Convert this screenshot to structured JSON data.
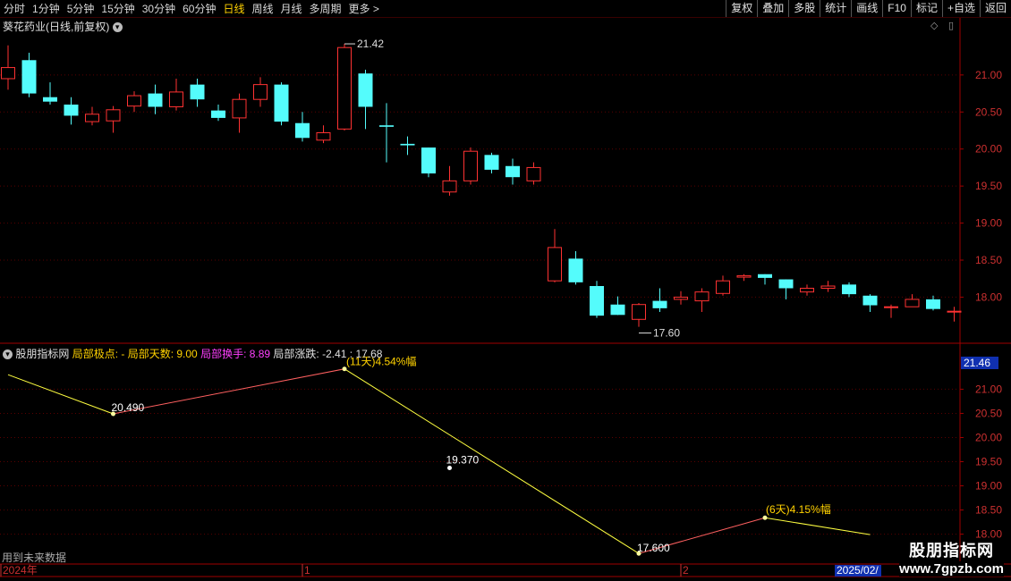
{
  "toolbar": {
    "periods": [
      "分时",
      "1分钟",
      "5分钟",
      "15分钟",
      "30分钟",
      "60分钟",
      "日线",
      "周线",
      "月线",
      "多周期",
      "更多 >"
    ],
    "active_period": "日线",
    "right_buttons": [
      "复权",
      "叠加",
      "多股",
      "统计",
      "画线",
      "F10",
      "标记",
      "+自选",
      "返回"
    ]
  },
  "main_chart": {
    "title": "葵花药业(日线,前复权)",
    "price_ticks": [
      "21.00",
      "20.50",
      "20.00",
      "19.50",
      "19.00",
      "18.50",
      "18.00"
    ],
    "high_label": "21.42",
    "low_label": "17.60"
  },
  "indicator": {
    "name": "股朋指标网",
    "items": [
      {
        "label": "局部极点: -",
        "color": "#ffd200"
      },
      {
        "label": "局部天数: 9.00",
        "color": "#ffd200"
      },
      {
        "label": "局部换手: 8.89",
        "color": "#ff40ff"
      },
      {
        "label": "局部涨跌: -2.41 : 17.68",
        "color": "#e0e0e0"
      }
    ],
    "ticks": [
      "21.00",
      "20.50",
      "20.00",
      "19.50",
      "19.00",
      "18.50",
      "18.00"
    ],
    "current_value": "21.46",
    "labels": [
      "20.490",
      "(11天)4.54%幅",
      "19.370",
      "17.600",
      "(6天)4.15%幅"
    ],
    "footer_note": "用到未来数据"
  },
  "time_axis": {
    "labels": [
      "2024年",
      "1",
      "2",
      "2025/02/"
    ]
  },
  "watermark": {
    "name": "股朋指标网",
    "url": "www.7gpzb.com"
  },
  "colors": {
    "up": "#ff3232",
    "down": "#54fcfc",
    "axis": "#a00000",
    "label": "#ffd200"
  },
  "chart_data": {
    "type": "candlestick",
    "series": [
      {
        "o": 20.95,
        "c": 21.1,
        "h": 21.4,
        "l": 20.8
      },
      {
        "o": 21.2,
        "c": 20.75,
        "h": 21.3,
        "l": 20.7
      },
      {
        "o": 20.7,
        "c": 20.64,
        "h": 20.9,
        "l": 20.6
      },
      {
        "o": 20.6,
        "c": 20.45,
        "h": 20.7,
        "l": 20.33
      },
      {
        "o": 20.37,
        "c": 20.47,
        "h": 20.57,
        "l": 20.32
      },
      {
        "o": 20.38,
        "c": 20.53,
        "h": 20.58,
        "l": 20.22
      },
      {
        "o": 20.58,
        "c": 20.72,
        "h": 20.78,
        "l": 20.5
      },
      {
        "o": 20.75,
        "c": 20.57,
        "h": 20.87,
        "l": 20.47
      },
      {
        "o": 20.57,
        "c": 20.77,
        "h": 20.95,
        "l": 20.52
      },
      {
        "o": 20.87,
        "c": 20.67,
        "h": 20.95,
        "l": 20.57
      },
      {
        "o": 20.52,
        "c": 20.42,
        "h": 20.6,
        "l": 20.38
      },
      {
        "o": 20.42,
        "c": 20.67,
        "h": 20.75,
        "l": 20.22
      },
      {
        "o": 20.67,
        "c": 20.87,
        "h": 20.97,
        "l": 20.57
      },
      {
        "o": 20.87,
        "c": 20.37,
        "h": 20.9,
        "l": 20.32
      },
      {
        "o": 20.35,
        "c": 20.15,
        "h": 20.5,
        "l": 20.1
      },
      {
        "o": 20.12,
        "c": 20.22,
        "h": 20.32,
        "l": 20.08
      },
      {
        "o": 20.27,
        "c": 21.37,
        "h": 21.42,
        "l": 20.25
      },
      {
        "o": 21.02,
        "c": 20.57,
        "h": 21.07,
        "l": 20.27
      },
      {
        "o": 20.32,
        "c": 20.3,
        "h": 20.62,
        "l": 19.82
      },
      {
        "o": 20.07,
        "c": 20.05,
        "h": 20.17,
        "l": 19.92
      },
      {
        "o": 20.02,
        "c": 19.67,
        "h": 20.02,
        "l": 19.62
      },
      {
        "o": 19.42,
        "c": 19.57,
        "h": 19.77,
        "l": 19.37
      },
      {
        "o": 19.57,
        "c": 19.97,
        "h": 20.02,
        "l": 19.52
      },
      {
        "o": 19.92,
        "c": 19.72,
        "h": 19.95,
        "l": 19.67
      },
      {
        "o": 19.77,
        "c": 19.62,
        "h": 19.87,
        "l": 19.52
      },
      {
        "o": 19.57,
        "c": 19.75,
        "h": 19.82,
        "l": 19.52
      },
      {
        "o": 18.22,
        "c": 18.67,
        "h": 18.92,
        "l": 18.2
      },
      {
        "o": 18.52,
        "c": 18.2,
        "h": 18.62,
        "l": 18.17
      },
      {
        "o": 18.15,
        "c": 17.75,
        "h": 18.22,
        "l": 17.72
      },
      {
        "o": 17.9,
        "c": 17.76,
        "h": 18.01,
        "l": 17.76
      },
      {
        "o": 17.7,
        "c": 17.9,
        "h": 17.92,
        "l": 17.6
      },
      {
        "o": 17.95,
        "c": 17.85,
        "h": 18.12,
        "l": 17.8
      },
      {
        "o": 17.97,
        "c": 18.0,
        "h": 18.08,
        "l": 17.9
      },
      {
        "o": 17.95,
        "c": 18.07,
        "h": 18.12,
        "l": 17.8
      },
      {
        "o": 18.05,
        "c": 18.22,
        "h": 18.29,
        "l": 18.02
      },
      {
        "o": 18.27,
        "c": 18.29,
        "h": 18.31,
        "l": 18.22
      },
      {
        "o": 18.31,
        "c": 18.26,
        "h": 18.31,
        "l": 18.17
      },
      {
        "o": 18.24,
        "c": 18.12,
        "h": 18.24,
        "l": 17.97
      },
      {
        "o": 18.07,
        "c": 18.12,
        "h": 18.17,
        "l": 18.02
      },
      {
        "o": 18.12,
        "c": 18.15,
        "h": 18.22,
        "l": 18.07
      },
      {
        "o": 18.17,
        "c": 18.04,
        "h": 18.2,
        "l": 18.0
      },
      {
        "o": 18.02,
        "c": 17.89,
        "h": 18.04,
        "l": 17.8
      },
      {
        "o": 17.86,
        "c": 17.87,
        "h": 17.9,
        "l": 17.72
      },
      {
        "o": 17.87,
        "c": 17.97,
        "h": 18.04,
        "l": 17.87
      },
      {
        "o": 17.97,
        "c": 17.84,
        "h": 18.02,
        "l": 17.82
      },
      {
        "o": 17.8,
        "c": 17.81,
        "h": 17.87,
        "l": 17.67
      }
    ],
    "zigzag": [
      {
        "i": 0,
        "v": 21.3
      },
      {
        "i": 5,
        "v": 20.49
      },
      {
        "i": 16,
        "v": 21.42
      },
      {
        "i": 30,
        "v": 17.6
      },
      {
        "i": 36,
        "v": 18.34
      },
      {
        "i": 41,
        "v": 17.99
      }
    ],
    "zigzag_dot": {
      "i": 21,
      "v": 19.37
    },
    "ylim_main": [
      17.45,
      21.65
    ],
    "ylim_indicator": [
      17.9,
      21.6
    ]
  }
}
